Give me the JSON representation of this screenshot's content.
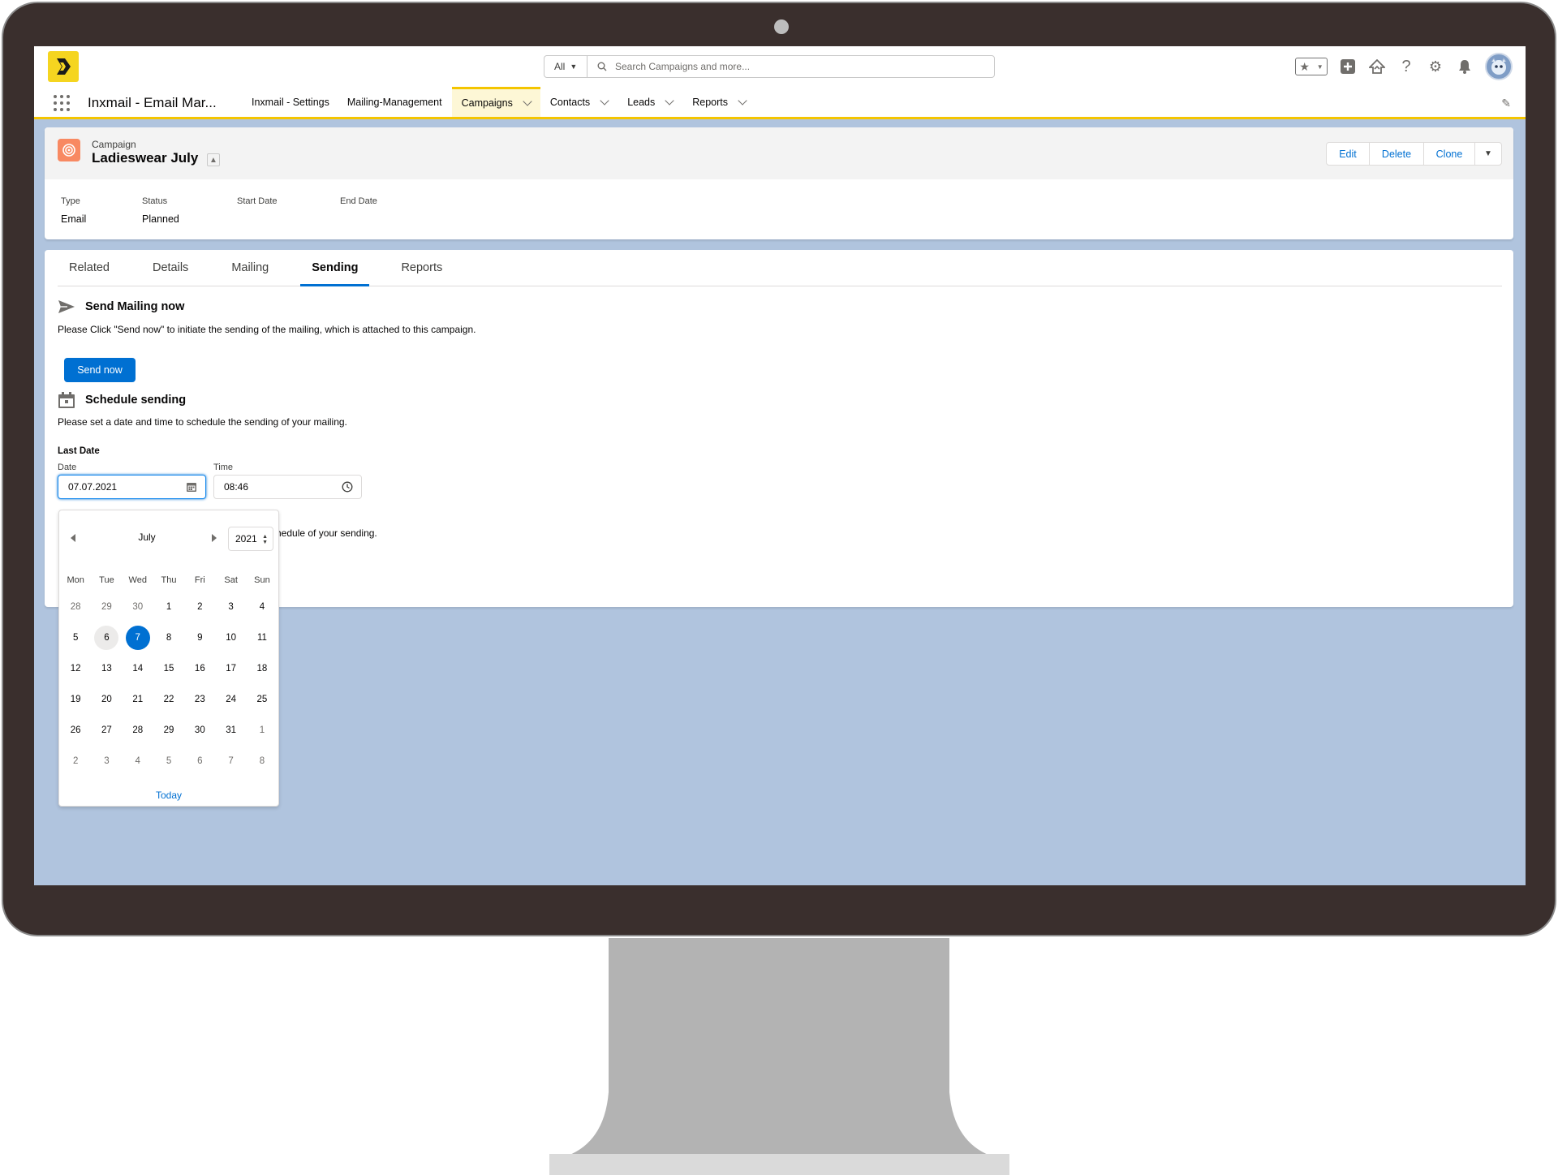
{
  "global_header": {
    "search_scope": "All",
    "search_placeholder": "Search Campaigns and more..."
  },
  "nav": {
    "app_name": "Inxmail - Email Mar...",
    "items": [
      {
        "label": "Inxmail - Settings"
      },
      {
        "label": "Mailing-Management"
      },
      {
        "label": "Campaigns"
      },
      {
        "label": "Contacts"
      },
      {
        "label": "Leads"
      },
      {
        "label": "Reports"
      }
    ]
  },
  "record": {
    "entity_label": "Campaign",
    "title": "Ladieswear July",
    "actions": [
      "Edit",
      "Delete",
      "Clone"
    ],
    "highlights": [
      {
        "label": "Type",
        "value": "Email"
      },
      {
        "label": "Status",
        "value": "Planned"
      },
      {
        "label": "Start Date",
        "value": ""
      },
      {
        "label": "End Date",
        "value": ""
      }
    ]
  },
  "tabs": [
    "Related",
    "Details",
    "Mailing",
    "Sending",
    "Reports"
  ],
  "active_tab": "Sending",
  "send_section": {
    "title": "Send Mailing now",
    "help": "Please Click \"Send now\" to initiate the sending of the mailing, which is attached to this campaign.",
    "button_label": "Send now"
  },
  "schedule_section": {
    "title": "Schedule sending",
    "help": "Please set a date and time to schedule the sending of your mailing.",
    "group_label": "Last Date",
    "date_label": "Date",
    "date_value": "07.07.2021",
    "time_label": "Time",
    "time_value": "08:46",
    "partial_text": "hedule of your sending."
  },
  "datepicker": {
    "month": "July",
    "year": "2021",
    "weekdays": [
      "Mon",
      "Tue",
      "Wed",
      "Thu",
      "Fri",
      "Sat",
      "Sun"
    ],
    "weeks": [
      [
        "28",
        "29",
        "30",
        "1",
        "2",
        "3",
        "4"
      ],
      [
        "5",
        "6",
        "7",
        "8",
        "9",
        "10",
        "11"
      ],
      [
        "12",
        "13",
        "14",
        "15",
        "16",
        "17",
        "18"
      ],
      [
        "19",
        "20",
        "21",
        "22",
        "23",
        "24",
        "25"
      ],
      [
        "26",
        "27",
        "28",
        "29",
        "30",
        "31",
        "1"
      ],
      [
        "2",
        "3",
        "4",
        "5",
        "6",
        "7",
        "8"
      ]
    ],
    "today_label": "Today"
  },
  "colors": {
    "brand_blue": "#0070d2",
    "accent_yellow": "#f4c500",
    "campaign_icon": "#f88962",
    "background": "#b0c4de"
  }
}
